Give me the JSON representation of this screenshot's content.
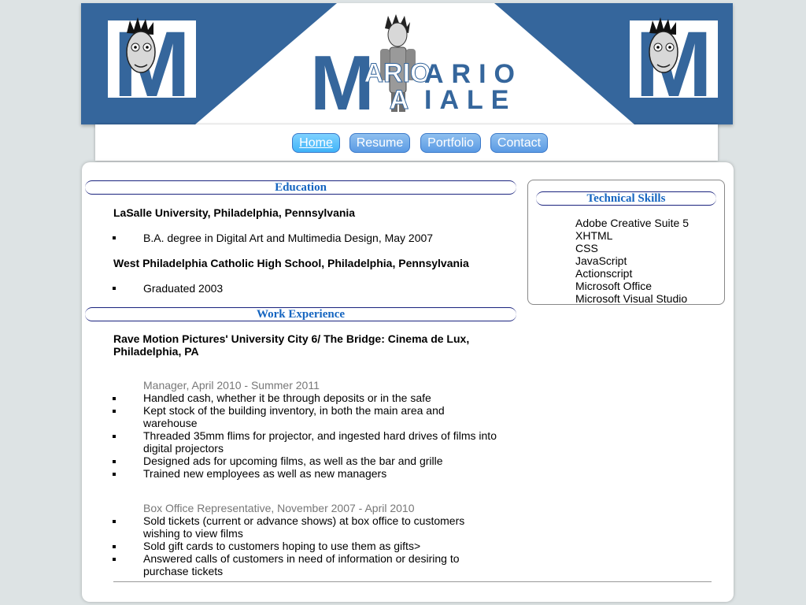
{
  "header": {
    "logo_letter": "M",
    "first_name_rest": "ARIO",
    "last_name_rest": "IALE",
    "first_initial": "M",
    "last_initial": "A"
  },
  "nav": {
    "items": [
      {
        "label": "Home",
        "active": true
      },
      {
        "label": "Resume",
        "active": false
      },
      {
        "label": "Portfolio",
        "active": false
      },
      {
        "label": "Contact",
        "active": false
      }
    ]
  },
  "education": {
    "heading": "Education",
    "schools": [
      {
        "name": "LaSalle University, Philadelphia, Pennsylvania",
        "details": [
          "B.A. degree in Digital Art and Multimedia Design, May 2007"
        ]
      },
      {
        "name": "West Philadelphia Catholic High School, Philadelphia, Pennsylvania",
        "details": [
          "Graduated 2003"
        ]
      }
    ]
  },
  "work": {
    "heading": "Work Experience",
    "employer": "Rave Motion Pictures' University City 6/ The Bridge: Cinema de Lux, Philadelphia, PA",
    "positions": [
      {
        "title": "Manager, April 2010 - Summer 2011",
        "duties": [
          "Handled cash, whether it be through deposits or in the safe",
          "Kept stock of the building inventory, in both the main area and warehouse",
          "Threaded 35mm flims for projector, and ingested hard drives of films into digital projectors",
          "Designed ads for upcoming films, as well as the bar and grille",
          "Trained new employees as well as new managers"
        ]
      },
      {
        "title": "Box Office Representative, November 2007 - April 2010",
        "duties": [
          "Sold tickets (current or advance shows) at box office to customers wishing to view films",
          "Sold gift cards to customers hoping to use them as gifts>",
          "Answered calls of customers in need of information or desiring to purchase tickets"
        ]
      }
    ]
  },
  "skills": {
    "heading": "Technical Skills",
    "items": [
      "Adobe Creative Suite 5",
      "XHTML",
      "CSS",
      "JavaScript",
      "Actionscript",
      "Microsoft Office",
      "Microsoft Visual Studio"
    ]
  },
  "colors": {
    "banner_blue": "#35669c",
    "heading_blue": "#1565c0",
    "nav_button": "#5a9ae4"
  }
}
